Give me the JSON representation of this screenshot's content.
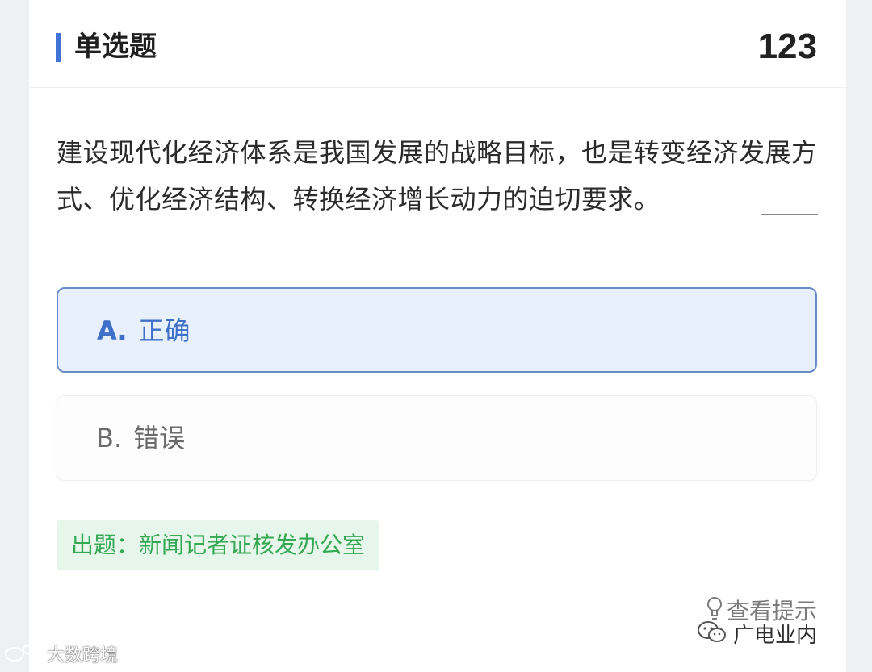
{
  "header": {
    "title": "单选题",
    "count": "123",
    "accent_color": "#3f74d6"
  },
  "question": {
    "text": "建设现代化经济体系是我国发展的战略目标，也是转变经济发展方式、优化经济结构、转换经济增长动力的迫切要求。"
  },
  "options": [
    {
      "letter": "A.",
      "text": "正确",
      "selected": true
    },
    {
      "letter": "B.",
      "text": "错误",
      "selected": false
    }
  ],
  "source": {
    "label": "出题：新闻记者证核发办公室",
    "color": "#34a853"
  },
  "hint": {
    "label": "查看提示",
    "icon": "lightbulb-icon"
  },
  "watermarks": {
    "right_text": "广电业内",
    "right_icon": "wechat-icon",
    "left_text": "大数跨境",
    "left_icon": "weibo-icon"
  }
}
